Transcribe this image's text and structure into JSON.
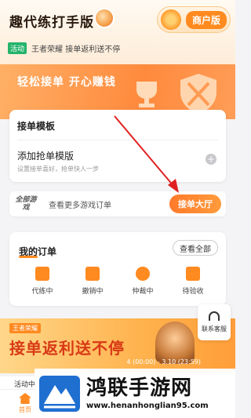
{
  "header": {
    "app_title": "趣代练打手版",
    "merchant_button": "商户版"
  },
  "notice": {
    "tag": "活动",
    "text": "王者荣耀  接单返利送不停"
  },
  "banner": {
    "slogan": "轻松接单 开心赚钱"
  },
  "template_card": {
    "title": "接单模板",
    "add_title": "添加抢单模版",
    "add_subtitle": "设置接单喜好，抢单快人一步",
    "add_icon": "+"
  },
  "lobby": {
    "games_label": "全部游戏",
    "hint": "查看更多游戏订单",
    "button": "接单大厅"
  },
  "orders": {
    "title": "我的订单",
    "view_all": "查看全部",
    "statuses": [
      {
        "label": "代练中",
        "icon": "doc-icon"
      },
      {
        "label": "撤销中",
        "icon": "undo-icon"
      },
      {
        "label": "仲裁中",
        "icon": "arbitration-icon"
      },
      {
        "label": "待验收",
        "icon": "check-icon"
      }
    ]
  },
  "promo": {
    "tag": "王者荣耀",
    "headline": "接单返利送不停",
    "date": "4 (00:00) - 3.10 (23:59)"
  },
  "support": {
    "label": "联系客服"
  },
  "activity": {
    "label": "活动中"
  },
  "tabbar": {
    "home_label": "首页"
  },
  "watermark": {
    "name": "鸿联手游网",
    "url": "www.henanhonglian95.com"
  },
  "colors": {
    "accent": "#ff8a1f",
    "arrow": "#e02020"
  }
}
